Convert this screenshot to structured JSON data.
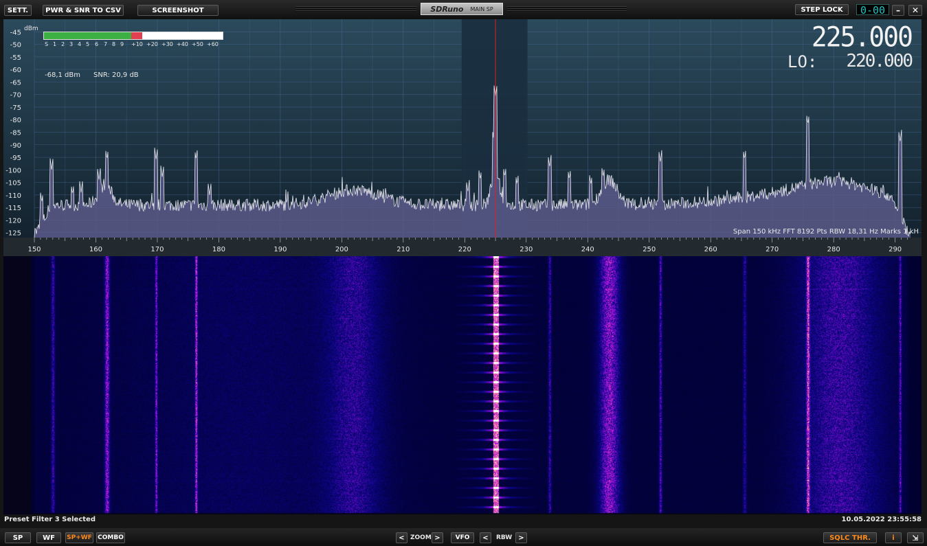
{
  "toolbar": {
    "sett_label": "SETT.",
    "pwr_label": "PWR & SNR TO CSV",
    "screenshot_label": "SCREENSHOT",
    "title_logo": "SDRuno",
    "title_sub": "MAIN SP",
    "step_lock_label": "STEP LOCK",
    "clock": "0-00",
    "minimize_glyph": "–",
    "close_glyph": "✕"
  },
  "meter": {
    "scale_labels": [
      "S",
      "1",
      "2",
      "3",
      "4",
      "5",
      "6",
      "7",
      "8",
      "9",
      "+10",
      "+20",
      "+30",
      "+40",
      "+50",
      "+60"
    ],
    "level_fraction": 0.55,
    "power_text": "-68,1 dBm",
    "snr_text": "SNR: 20,9 dB"
  },
  "frequency": {
    "main": "225.000",
    "lo_label": "LO:",
    "lo": "220.000"
  },
  "spectrum": {
    "y_unit": "dBm",
    "y_ticks": [
      -45,
      -50,
      -55,
      -60,
      -65,
      -70,
      -75,
      -80,
      -85,
      -90,
      -95,
      -100,
      -105,
      -110,
      -115,
      -120,
      -125
    ],
    "x_ticks": [
      150,
      160,
      170,
      180,
      190,
      200,
      210,
      220,
      230,
      240,
      250,
      260,
      270,
      280,
      290
    ],
    "x_range_khz": [
      150,
      292.5
    ],
    "y_range_dbm": [
      -40,
      -127
    ],
    "tuned_khz": 225,
    "passband_khz": [
      219.5,
      230.2
    ],
    "status_text": "Span 150 kHz   FFT 8192 Pts   RBW 18,31 Hz   Marks 1 kH",
    "peaks": [
      {
        "khz": 150.3,
        "dbm": -127
      },
      {
        "khz": 151.2,
        "dbm": -113
      },
      {
        "khz": 152.8,
        "dbm": -100
      },
      {
        "khz": 156.2,
        "dbm": -110
      },
      {
        "khz": 157.6,
        "dbm": -109
      },
      {
        "khz": 160.5,
        "dbm": -104
      },
      {
        "khz": 161.8,
        "dbm": -96
      },
      {
        "khz": 169.8,
        "dbm": -96
      },
      {
        "khz": 170.8,
        "dbm": -103
      },
      {
        "khz": 176.3,
        "dbm": -96
      },
      {
        "khz": 178.5,
        "dbm": -110
      },
      {
        "khz": 220.5,
        "dbm": -109
      },
      {
        "khz": 222.5,
        "dbm": -104
      },
      {
        "khz": 224.7,
        "dbm": -88
      },
      {
        "khz": 225.0,
        "dbm": -71
      },
      {
        "khz": 226.5,
        "dbm": -103
      },
      {
        "khz": 228.5,
        "dbm": -106
      },
      {
        "khz": 233.8,
        "dbm": -99
      },
      {
        "khz": 237.0,
        "dbm": -104
      },
      {
        "khz": 240.5,
        "dbm": -106
      },
      {
        "khz": 242.5,
        "dbm": -103
      },
      {
        "khz": 251.8,
        "dbm": -97
      },
      {
        "khz": 265.5,
        "dbm": -96
      },
      {
        "khz": 275.8,
        "dbm": -82
      },
      {
        "khz": 290.8,
        "dbm": -89
      }
    ]
  },
  "waterfall": {
    "bands": [
      {
        "khz": 202,
        "width_khz": 9,
        "strength": 0.45
      },
      {
        "khz": 243.5,
        "width_khz": 3.5,
        "strength": 0.9
      },
      {
        "khz": 281,
        "width_khz": 14,
        "strength": 0.6
      },
      {
        "khz": 161.8,
        "width_khz": 0.8,
        "strength": 0.9
      },
      {
        "khz": 153,
        "width_khz": 0.6,
        "strength": 0.6
      },
      {
        "khz": 169.8,
        "width_khz": 0.4,
        "strength": 0.8
      },
      {
        "khz": 176.3,
        "width_khz": 0.4,
        "strength": 1.0
      },
      {
        "khz": 251.8,
        "width_khz": 0.5,
        "strength": 0.7
      },
      {
        "khz": 275.8,
        "width_khz": 0.5,
        "strength": 1.0
      },
      {
        "khz": 290.8,
        "width_khz": 0.4,
        "strength": 0.7
      },
      {
        "khz": 265.5,
        "width_khz": 0.6,
        "strength": 0.5
      },
      {
        "khz": 233.8,
        "width_khz": 0.5,
        "strength": 0.6
      }
    ],
    "status_left": "Preset Filter 3 Selected",
    "status_right": "10.05.2022 23:55:58"
  },
  "bottom": {
    "sp_label": "SP",
    "wf_label": "WF",
    "spwf_label": "SP+WF",
    "combo_label": "COMBO",
    "zoom_label": "ZOOM",
    "vfo_label": "VFO",
    "rbw_label": "RBW",
    "left_arrow": "<",
    "right_arrow": ">",
    "sqlc_label": "SQLC THR.",
    "info_label": "i",
    "resize_glyph": "⇲"
  },
  "colors": {
    "trace": "#e8e8f0",
    "fill": "#5a5a8a",
    "marker": "#e02020",
    "meter_green": "#3cb043",
    "meter_red": "#e04050",
    "accent_orange": "#ff8a1c"
  }
}
